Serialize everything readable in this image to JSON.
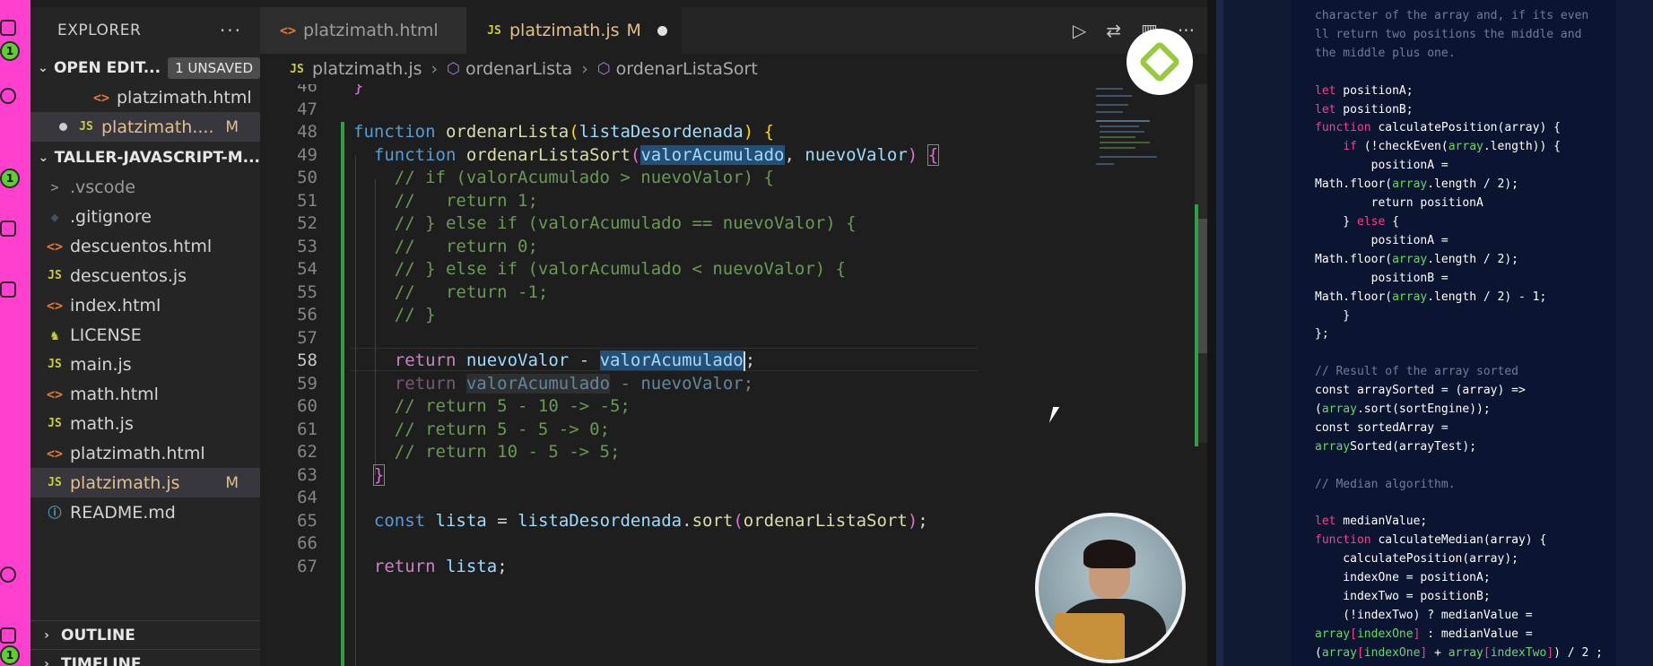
{
  "sidebar": {
    "title": "EXPLORER",
    "more_icon": "···",
    "open_editors": {
      "label": "OPEN EDIT...",
      "badge": "1 UNSAVED",
      "items": [
        {
          "icon": "<>",
          "name": "platzimath.html",
          "status": ""
        },
        {
          "icon": "JS",
          "name": "platzimath.js",
          "name_display": "platzimath....",
          "status": "M"
        }
      ]
    },
    "project": {
      "label": "TALLER-JAVASCRIPT-M...",
      "items": [
        {
          "icon": ">",
          "name": ".vscode",
          "status": ""
        },
        {
          "icon": "◆",
          "name": ".gitignore",
          "status": ""
        },
        {
          "icon": "<>",
          "name": "descuentos.html",
          "status": ""
        },
        {
          "icon": "JS",
          "name": "descuentos.js",
          "status": ""
        },
        {
          "icon": "<>",
          "name": "index.html",
          "status": ""
        },
        {
          "icon": "♞",
          "name": "LICENSE",
          "status": ""
        },
        {
          "icon": "JS",
          "name": "main.js",
          "status": ""
        },
        {
          "icon": "<>",
          "name": "math.html",
          "status": ""
        },
        {
          "icon": "JS",
          "name": "math.js",
          "status": ""
        },
        {
          "icon": "<>",
          "name": "platzimath.html",
          "status": ""
        },
        {
          "icon": "JS",
          "name": "platzimath.js",
          "status": "M"
        },
        {
          "icon": "ⓘ",
          "name": "README.md",
          "status": ""
        }
      ]
    },
    "outline_label": "OUTLINE",
    "timeline_label": "TIMELINE"
  },
  "activity_badges": [
    "1",
    "1",
    "1"
  ],
  "tabs": [
    {
      "icon": "<>",
      "label": "platzimath.html"
    },
    {
      "icon": "JS",
      "label": "platzimath.js",
      "status": "M"
    }
  ],
  "breadcrumb": {
    "file_icon": "JS",
    "file": "platzimath.js",
    "crumb1": "ordenarLista",
    "crumb2": "ordenarListaSort"
  },
  "editor": {
    "line_numbers": [
      "46",
      "47",
      "48",
      "49",
      "50",
      "51",
      "52",
      "53",
      "54",
      "55",
      "56",
      "57",
      "58",
      "59",
      "60",
      "61",
      "62",
      "63",
      "64",
      "65",
      "66",
      "67"
    ],
    "current_line": "58"
  },
  "blog_code": {
    "intro_lines": [
      "character of the array and, if its even",
      "ll return two positions the middle and",
      "the middle plus one."
    ]
  },
  "colors": {
    "activity_bar": "#ff3fce",
    "modified": "#e2c08d",
    "git_added": "#2ea043",
    "platzi_green": "#98ca3f",
    "blog_keyword": "#ff3d8a",
    "blog_identifier": "#64d96b"
  }
}
